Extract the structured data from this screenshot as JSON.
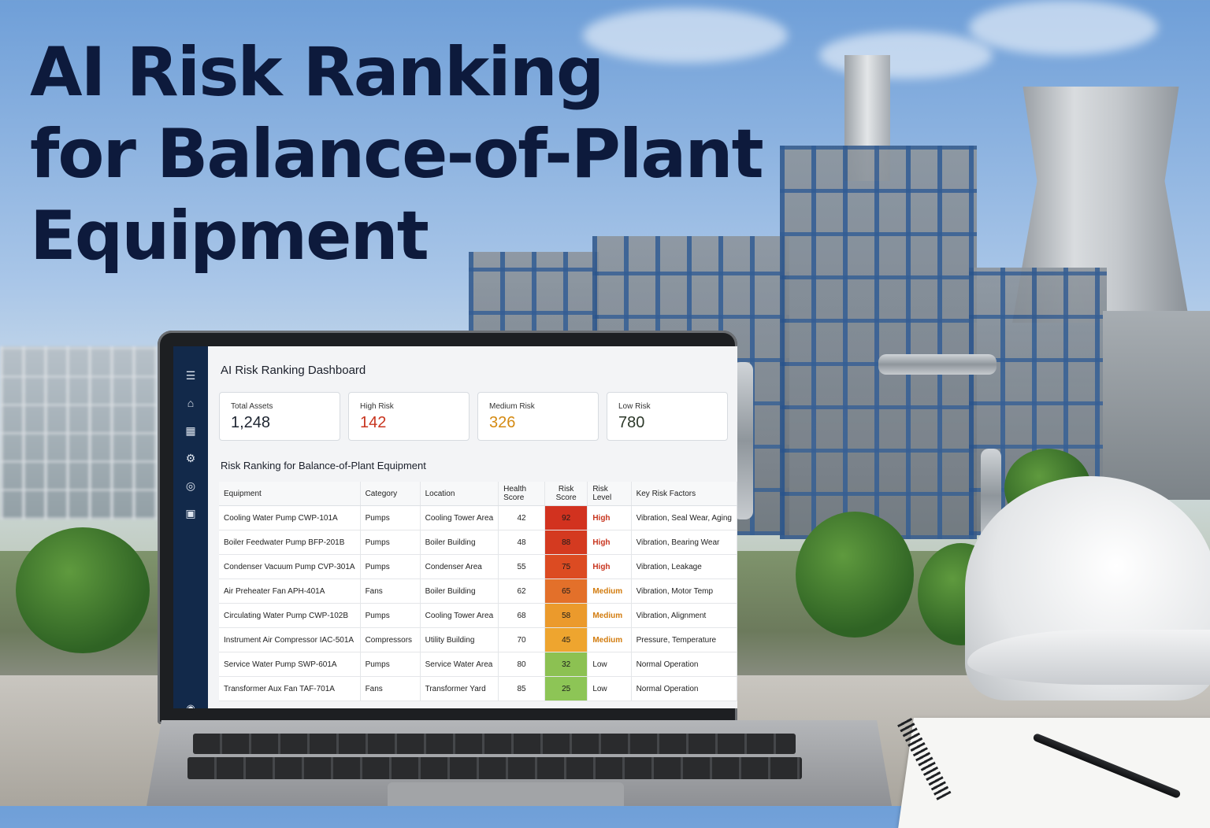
{
  "headline": {
    "line1": "AI Risk Ranking",
    "line2": "for Balance-of-Plant",
    "line3": "Equipment"
  },
  "dashboard": {
    "title": "AI Risk Ranking Dashboard",
    "sidebar_icons": [
      "menu-icon",
      "home-icon",
      "dashboard-icon",
      "assets-icon",
      "reports-icon",
      "settings-icon",
      "user-icon"
    ],
    "stats": [
      {
        "label": "Total Assets",
        "value": "1,248"
      },
      {
        "label": "High Risk",
        "value": "142"
      },
      {
        "label": "Medium Risk",
        "value": "326"
      },
      {
        "label": "Low Risk",
        "value": "780"
      }
    ],
    "table_title": "Risk Ranking for Balance-of-Plant Equipment",
    "columns": [
      "Equipment",
      "Category",
      "Location",
      "Health Score",
      "Risk Score",
      "Risk Level",
      "Key Risk Factors"
    ],
    "rows": [
      {
        "equipment": "Cooling Water Pump CWP-101A",
        "category": "Pumps",
        "location": "Cooling Tower Area",
        "health": "42",
        "risk": "92",
        "level": "High",
        "factors": "Vibration, Seal Wear, Aging",
        "color": "#d2321f"
      },
      {
        "equipment": "Boiler Feedwater Pump BFP-201B",
        "category": "Pumps",
        "location": "Boiler Building",
        "health": "48",
        "risk": "88",
        "level": "High",
        "factors": "Vibration, Bearing Wear",
        "color": "#d43a20"
      },
      {
        "equipment": "Condenser Vacuum Pump CVP-301A",
        "category": "Pumps",
        "location": "Condenser Area",
        "health": "55",
        "risk": "75",
        "level": "High",
        "factors": "Vibration, Leakage",
        "color": "#dc4b22"
      },
      {
        "equipment": "Air Preheater Fan APH-401A",
        "category": "Fans",
        "location": "Boiler Building",
        "health": "62",
        "risk": "65",
        "level": "Medium",
        "factors": "Vibration, Motor Temp",
        "color": "#e3702a"
      },
      {
        "equipment": "Circulating Water Pump CWP-102B",
        "category": "Pumps",
        "location": "Cooling Tower Area",
        "health": "68",
        "risk": "58",
        "level": "Medium",
        "factors": "Vibration, Alignment",
        "color": "#eb9a2c"
      },
      {
        "equipment": "Instrument Air Compressor IAC-501A",
        "category": "Compressors",
        "location": "Utility Building",
        "health": "70",
        "risk": "45",
        "level": "Medium",
        "factors": "Pressure, Temperature",
        "color": "#eea52f"
      },
      {
        "equipment": "Service Water Pump SWP-601A",
        "category": "Pumps",
        "location": "Service Water Area",
        "health": "80",
        "risk": "32",
        "level": "Low",
        "factors": "Normal Operation",
        "color": "#8cc152"
      },
      {
        "equipment": "Transformer Aux Fan TAF-701A",
        "category": "Fans",
        "location": "Transformer Yard",
        "health": "85",
        "risk": "25",
        "level": "Low",
        "factors": "Normal Operation",
        "color": "#8dc556"
      }
    ]
  }
}
